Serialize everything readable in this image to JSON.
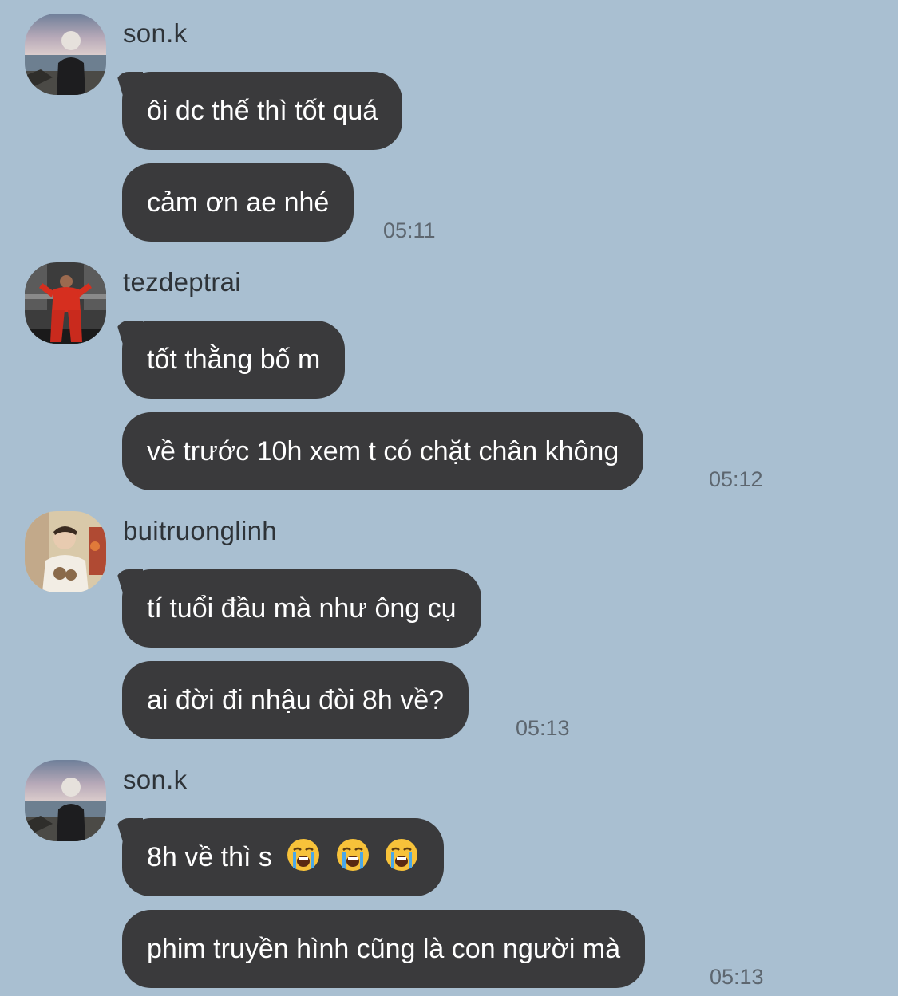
{
  "messages": [
    {
      "sender": "son.k",
      "avatar_icon": "avatar-son-k",
      "bubbles": [
        "ôi dc thế thì tốt quá",
        "cảm ơn ae nhé"
      ],
      "time": "05:11"
    },
    {
      "sender": "tezdeptrai",
      "avatar_icon": "avatar-tezdeptrai",
      "bubbles": [
        "tốt thằng bố m",
        "về trước 10h xem t có chặt chân không"
      ],
      "time": "05:12"
    },
    {
      "sender": "buitruonglinh",
      "avatar_icon": "avatar-buitruonglinh",
      "bubbles": [
        "tí tuổi đầu mà như ông cụ",
        "ai đời đi nhậu đòi 8h về?"
      ],
      "time": "05:13"
    },
    {
      "sender": "son.k",
      "avatar_icon": "avatar-son-k",
      "bubbles": [
        "8h về thì s",
        "phim truyền hình cũng là con người mà"
      ],
      "bubble_emoji": "loudly-crying-face ×3",
      "time": "05:13"
    }
  ],
  "colors": {
    "background": "#a9bfd1",
    "bubble": "#3a3a3c",
    "bubble_text": "#ffffff",
    "sender_text": "#2e3338",
    "time_text": "#5d666f"
  }
}
